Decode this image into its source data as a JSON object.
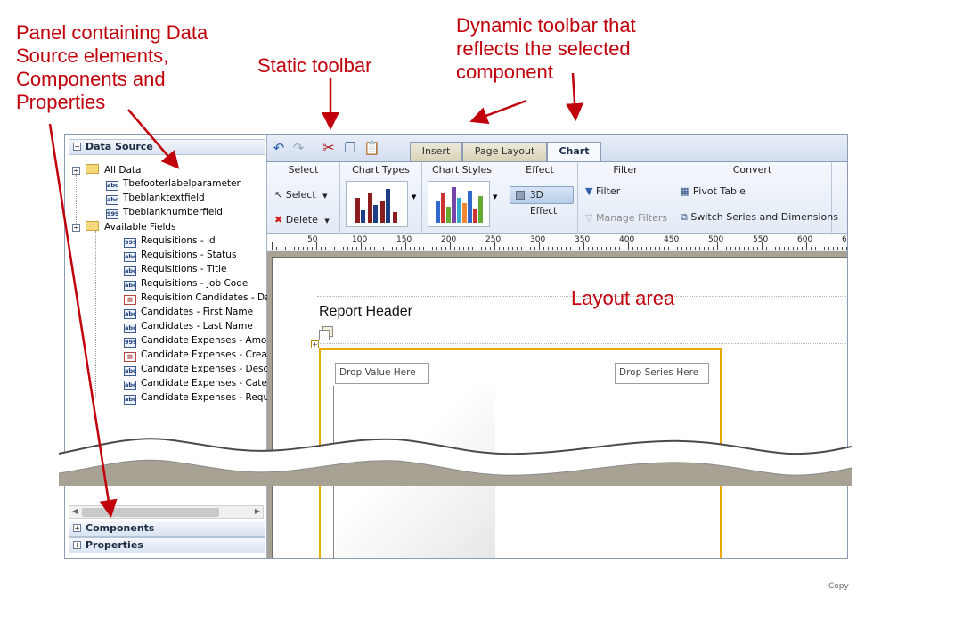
{
  "annotations": {
    "panel": "Panel containing Data\nSource elements,\nComponents and\nProperties",
    "static_toolbar": "Static toolbar",
    "dynamic_toolbar": "Dynamic toolbar that\nreflects the selected\ncomponent",
    "layout_area": "Layout area",
    "arrow_color": "#c0000a"
  },
  "left_panel": {
    "data_source_header": "Data Source",
    "tree": [
      {
        "label": "All Data",
        "icon": "folder-open-icon"
      },
      {
        "label": "Tbefooterlabelparameter",
        "icon": "abc"
      },
      {
        "label": "Tbeblanktextfield",
        "icon": "abc"
      },
      {
        "label": "Tbeblanknumberfield",
        "icon": "999"
      },
      {
        "label": "Available Fields",
        "icon": "folder-open-icon"
      },
      {
        "label": "Requisitions - Id",
        "icon": "999"
      },
      {
        "label": "Requisitions - Status",
        "icon": "abc"
      },
      {
        "label": "Requisitions - Title",
        "icon": "abc"
      },
      {
        "label": "Requisitions - Job Code",
        "icon": "abc"
      },
      {
        "label": "Requisition Candidates - Da",
        "icon": "date"
      },
      {
        "label": "Candidates - First Name",
        "icon": "abc"
      },
      {
        "label": "Candidates - Last Name",
        "icon": "abc"
      },
      {
        "label": "Candidate Expenses - Amou",
        "icon": "999"
      },
      {
        "label": "Candidate Expenses - Creat",
        "icon": "date"
      },
      {
        "label": "Candidate Expenses - Descr",
        "icon": "abc"
      },
      {
        "label": "Candidate Expenses - Categ",
        "icon": "abc"
      },
      {
        "label": "Candidate Expenses - Requ",
        "icon": "abc"
      }
    ],
    "components_header": "Components",
    "properties_header": "Properties"
  },
  "toolbar": {
    "tabs": [
      "Insert",
      "Page Layout",
      "Chart"
    ],
    "active_tab": "Chart",
    "groups": {
      "select": {
        "title": "Select",
        "select_label": "Select",
        "delete_label": "Delete"
      },
      "chart_types": {
        "title": "Chart Types"
      },
      "chart_styles": {
        "title": "Chart Styles"
      },
      "effect": {
        "title": "Effect",
        "button": "3D Effect"
      },
      "filter": {
        "title": "Filter",
        "filter_label": "Filter",
        "manage_label": "Manage Filters"
      },
      "convert": {
        "title": "Convert",
        "pivot_label": "Pivot Table",
        "switch_label": "Switch Series and Dimensions"
      }
    }
  },
  "ruler": {
    "labels": [
      "50",
      "100",
      "150",
      "200",
      "250",
      "300",
      "350",
      "400",
      "450",
      "500",
      "550",
      "600",
      "6"
    ]
  },
  "layout": {
    "report_header": "Report Header",
    "drop_value": "Drop Value Here",
    "drop_series": "Drop Series Here",
    "chart_border_color": "#e8a800"
  },
  "footer": {
    "copy_text": "Copy"
  }
}
